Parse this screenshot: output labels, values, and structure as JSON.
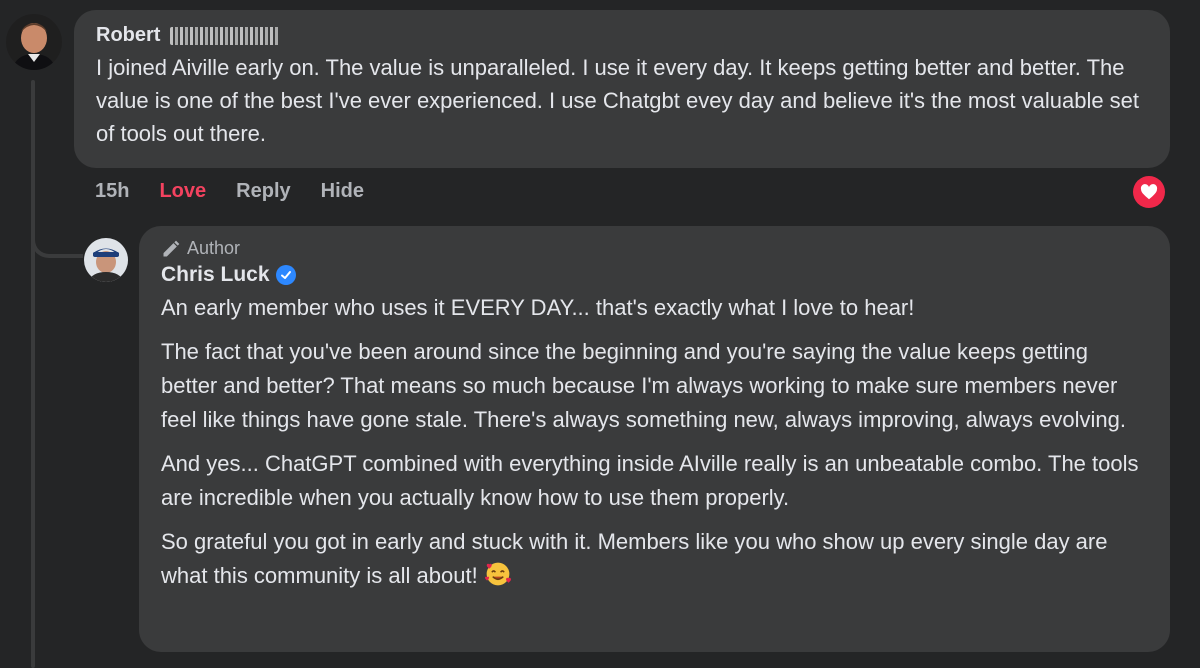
{
  "comment": {
    "author_first_name": "Robert",
    "text": "I joined Aiville early on. The value is unparalleled. I use it every day. It keeps getting better and better. The value is one of the best I've ever experienced. I use Chatgbt evey day and believe it's the most valuable set of tools out there.",
    "time": "15h",
    "actions": {
      "love": "Love",
      "reply": "Reply",
      "hide": "Hide"
    },
    "reaction_icon": "heart-icon",
    "reaction_color": "#f0284a"
  },
  "reply": {
    "badge": "Author",
    "author_name": "Chris Luck",
    "verified_icon": "verified-badge-icon",
    "paragraphs": [
      "An early member who uses it EVERY DAY... that's exactly what I love to hear!",
      "The fact that you've been around since the beginning and you're saying the value keeps getting better and better? That means so much because I'm always working to make sure members never feel like things have gone stale. There's always something new, always improving, always evolving.",
      "And yes... ChatGPT combined with everything inside AIville really is an unbeatable combo. The tools are incredible when you actually know how to use them properly.",
      "So grateful you got in early and stuck with it. Members like you who show up every single day are what this community is all about!"
    ],
    "emoji": "smiling-face-with-hearts-emoji"
  },
  "colors": {
    "background": "#242526",
    "bubble": "#3a3b3c",
    "love_active": "#f3425f",
    "verified": "#2d88ff"
  }
}
